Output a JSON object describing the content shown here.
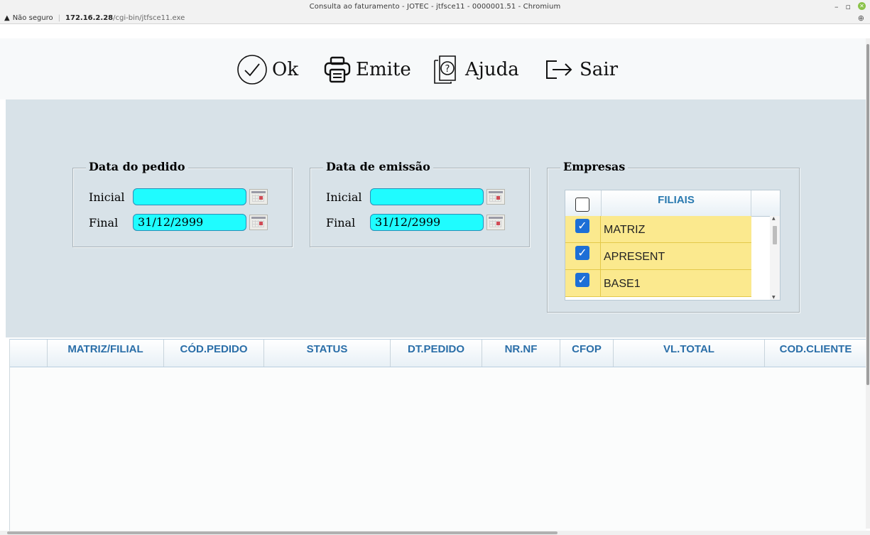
{
  "window": {
    "title": "Consulta ao faturamento - JOTEC - jtfsce11 - 0000001.51 - Chromium"
  },
  "addressbar": {
    "security": "Não seguro",
    "host": "172.16.2.28",
    "path": "/cgi-bin/jtfsce11.exe"
  },
  "toolbar": {
    "ok_label": "Ok",
    "emite_label": "Emite",
    "ajuda_label": "Ajuda",
    "sair_label": "Sair"
  },
  "data_pedido": {
    "legend": "Data do pedido",
    "inicial_label": "Inicial",
    "inicial_value": "",
    "final_label": "Final",
    "final_value": "31/12/2999"
  },
  "data_emissao": {
    "legend": "Data de emissão",
    "inicial_label": "Inicial",
    "inicial_value": "",
    "final_label": "Final",
    "final_value": "31/12/2999"
  },
  "empresas": {
    "legend": "Empresas",
    "header": "FILIAIS",
    "select_all_checked": false,
    "rows": [
      {
        "name": "MATRIZ",
        "checked": true
      },
      {
        "name": "APRESENT",
        "checked": true
      },
      {
        "name": "BASE1",
        "checked": true
      }
    ]
  },
  "results": {
    "columns": [
      "",
      "MATRIZ/FILIAL",
      "CÓD.PEDIDO",
      "STATUS",
      "DT.PEDIDO",
      "NR.NF",
      "CFOP",
      "VL.TOTAL",
      "COD.CLIENTE"
    ],
    "rows": []
  },
  "colors": {
    "date_field_bg": "#1ffcff",
    "panel_bg": "#d8e2e8",
    "row_highlight": "#fbe98e",
    "header_text": "#2a6ea8",
    "checkbox_blue": "#1d6fd6"
  }
}
